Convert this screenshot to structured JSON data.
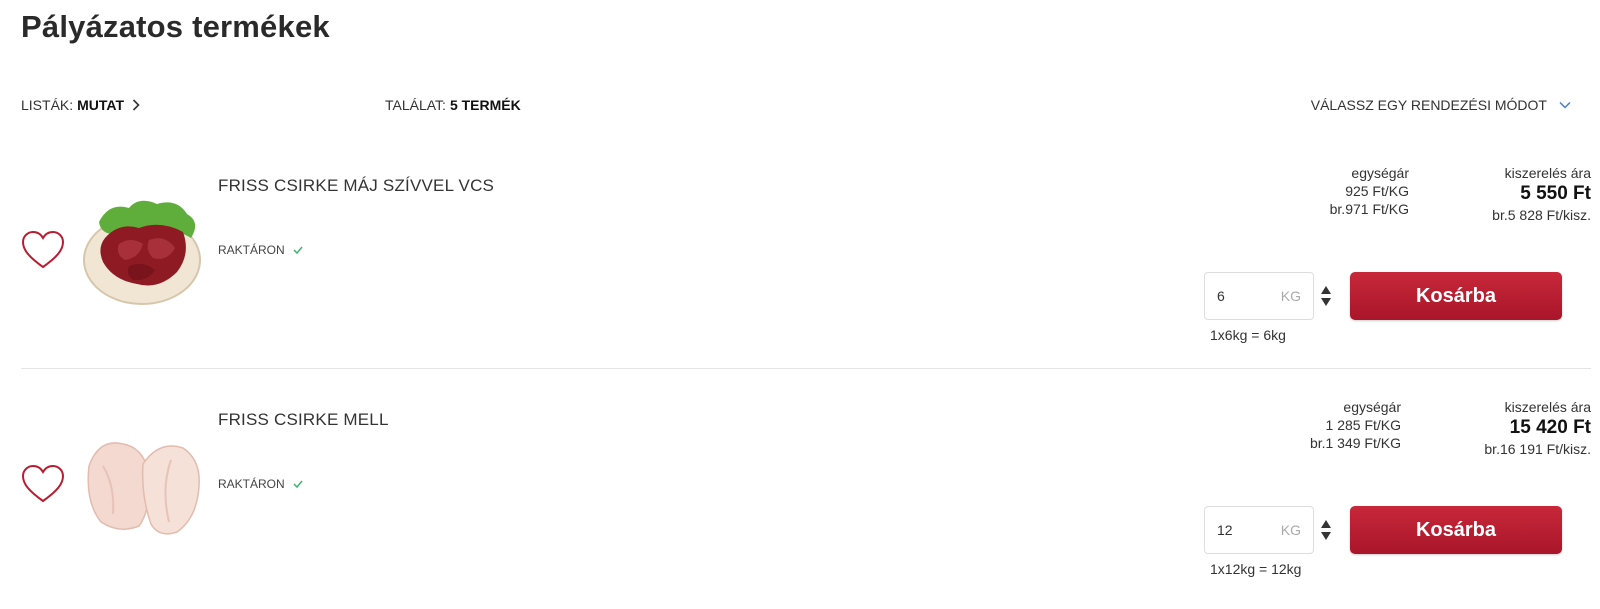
{
  "page": {
    "title": "Pályázatos termékek"
  },
  "toolbar": {
    "lists_label": "LISTÁK:",
    "lists_value": "MUTAT",
    "results_label": "TALÁLAT:",
    "results_value": "5 TERMÉK",
    "sort_label": "VÁLASSZ EGY RENDEZÉSI MÓDOT"
  },
  "colors": {
    "accent": "#b81c30",
    "stock_ok": "#3cb371",
    "divider": "#e4e4e4"
  },
  "products": [
    {
      "name": "FRISS CSIRKE MÁJ SZÍVVEL VCS",
      "stock": "RAKTÁRON",
      "unit_price_label": "egységár",
      "unit_price": "925 Ft/KG",
      "unit_price_gross": "br.971 Ft/KG",
      "pack_price_label": "kiszerelés ára",
      "pack_price": "5 550 Ft",
      "pack_price_gross": "br.5 828 Ft/kisz.",
      "qty": "6",
      "qty_unit": "KG",
      "button": "Kosárba",
      "conversion": "1x6kg = 6kg",
      "icon": "liver-product-image"
    },
    {
      "name": "FRISS CSIRKE MELL",
      "stock": "RAKTÁRON",
      "unit_price_label": "egységár",
      "unit_price": "1 285 Ft/KG",
      "unit_price_gross": "br.1 349 Ft/KG",
      "pack_price_label": "kiszerelés ára",
      "pack_price": "15 420 Ft",
      "pack_price_gross": "br.16 191 Ft/kisz.",
      "qty": "12",
      "qty_unit": "KG",
      "button": "Kosárba",
      "conversion": "1x12kg = 12kg",
      "icon": "chicken-breast-product-image"
    }
  ]
}
